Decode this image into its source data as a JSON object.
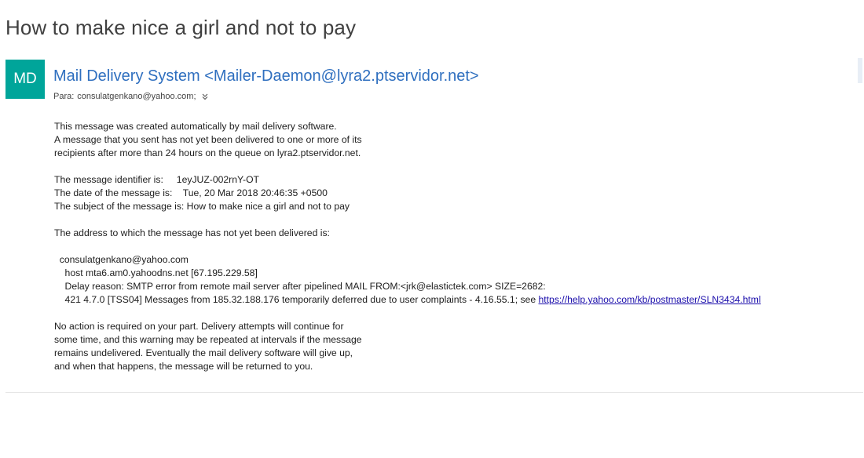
{
  "message": {
    "subject": "How to make nice a girl and not to pay",
    "avatar_initials": "MD",
    "avatar_color": "#00a59a",
    "sender": "Mail Delivery System <Mailer-Daemon@lyra2.ptservidor.net>",
    "to_label": "Para:",
    "to_address": "consulatgenkano@yahoo.com;",
    "expand_icon": "chevron-double-down-icon"
  },
  "body": {
    "intro": [
      "This message was created automatically by mail delivery software.",
      "A message that you sent has not yet been delivered to one or more of its",
      "recipients after more than 24 hours on the queue on lyra2.ptservidor.net."
    ],
    "details": [
      "The message identifier is:     1eyJUZ-002rnY-OT",
      "The date of the message is:    Tue, 20 Mar 2018 20:46:35 +0500",
      "The subject of the message is: How to make nice a girl and not to pay"
    ],
    "address_intro": "The address to which the message has not yet been delivered is:",
    "recipient_block": [
      "  consulatgenkano@yahoo.com",
      "    host mta6.am0.yahoodns.net [67.195.229.58]",
      "    Delay reason: SMTP error from remote mail server after pipelined MAIL FROM:<jrk@elastictek.com> SIZE=2682:"
    ],
    "error_line_prefix": "    421 4.7.0 [TSS04] Messages from 185.32.188.176 temporarily deferred due to user complaints - 4.16.55.1; see ",
    "error_link": "https://help.yahoo.com/kb/postmaster/SLN3434.html",
    "closing": [
      "No action is required on your part. Delivery attempts will continue for",
      "some time, and this warning may be repeated at intervals if the message",
      "remains undelivered. Eventually the mail delivery software will give up,",
      "and when that happens, the message will be returned to you."
    ]
  }
}
